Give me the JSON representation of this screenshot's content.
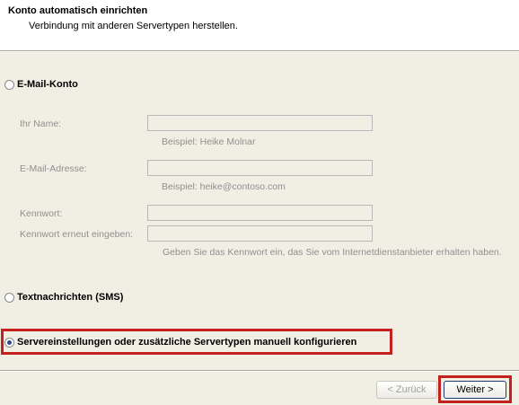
{
  "header": {
    "title": "Konto automatisch einrichten",
    "subtitle": "Verbindung mit anderen Servertypen herstellen."
  },
  "options": {
    "email": {
      "label": "E-Mail-Konto",
      "checked": false
    },
    "sms": {
      "label": "Textnachrichten (SMS)",
      "checked": false
    },
    "manual": {
      "label": "Servereinstellungen oder zusätzliche Servertypen manuell konfigurieren",
      "checked": true
    }
  },
  "form": {
    "name_label": "Ihr Name:",
    "name_value": "",
    "name_hint": "Beispiel: Heike Molnar",
    "email_label": "E-Mail-Adresse:",
    "email_value": "",
    "email_hint": "Beispiel: heike@contoso.com",
    "password_label": "Kennwort:",
    "password_value": "",
    "password_repeat_label": "Kennwort erneut eingeben:",
    "password_repeat_value": "",
    "password_hint": "Geben Sie das Kennwort ein, das Sie vom Internetdienstanbieter erhalten haben."
  },
  "buttons": {
    "back": "< Zurück",
    "next": "Weiter >"
  },
  "colors": {
    "highlight": "#c42020",
    "background": "#f1efe4"
  }
}
